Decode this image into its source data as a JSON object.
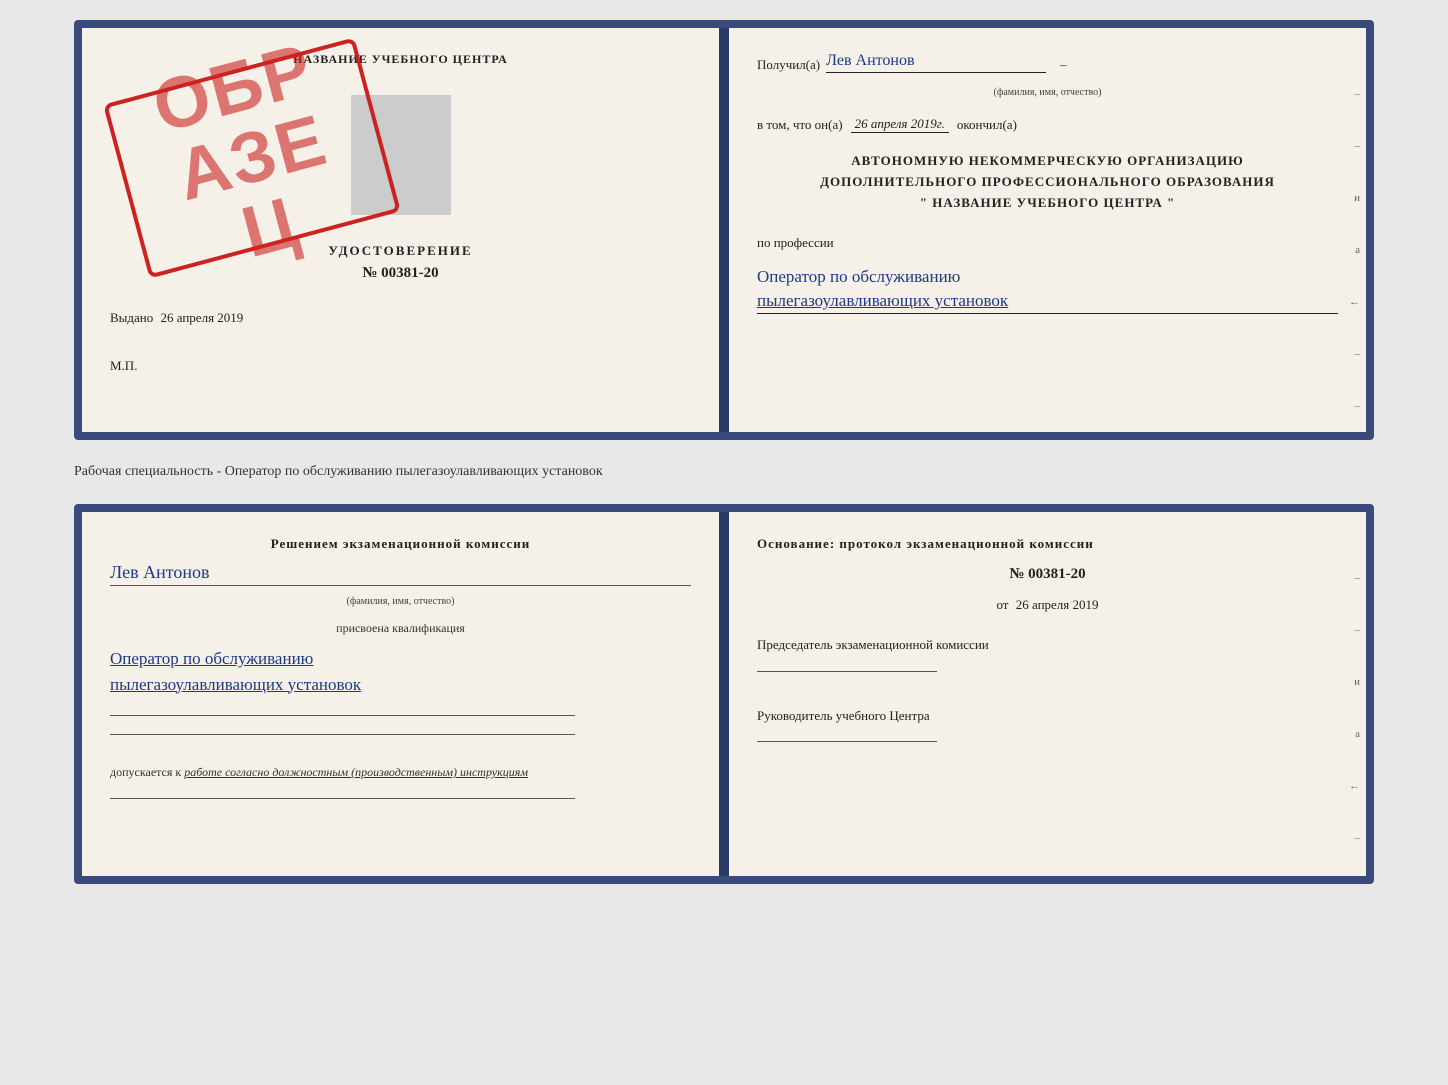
{
  "cert": {
    "left": {
      "center_name": "НАЗВАНИЕ УЧЕБНОГО ЦЕНТРА",
      "udostoverenie": "УДОСТОВЕРЕНИЕ",
      "number": "№ 00381-20",
      "stamp": "ОБР\nАЗЕЦ",
      "vydano_label": "Выдано",
      "vydano_date": "26 апреля 2019",
      "mp": "М.П."
    },
    "right": {
      "poluchil_label": "Получил(а)",
      "poluchil_name": "Лев Антонов",
      "fio_hint": "(фамилия, имя, отчество)",
      "dash": "–",
      "vtom_prefix": "в том, что он(а)",
      "vtom_date": "26 апреля 2019г.",
      "okonchil": "окончил(а)",
      "org_line1": "АВТОНОМНУЮ НЕКОММЕРЧЕСКУЮ ОРГАНИЗАЦИЮ",
      "org_line2": "ДОПОЛНИТЕЛЬНОГО ПРОФЕССИОНАЛЬНОГО ОБРАЗОВАНИЯ",
      "org_line3": "\"  НАЗВАНИЕ УЧЕБНОГО ЦЕНТРА  \"",
      "po_professii": "по профессии",
      "prof_line1": "Оператор по обслуживанию",
      "prof_line2": "пылегазоулавливающих установок"
    }
  },
  "middle_text": "Рабочая специальность - Оператор по обслуживанию пылегазоулавливающих установок",
  "bottom": {
    "left": {
      "resheniem": "Решением экзаменационной комиссии",
      "fio": "Лев Антонов",
      "fio_hint": "(фамилия, имя, отчество)",
      "prisvoena": "присвоена квалификация",
      "kvali_1": "Оператор по обслуживанию",
      "kvali_2": "пылегазоулавливающих установок",
      "dopusk_prefix": "допускается к",
      "dopusk_italic": "работе согласно должностным (производственным) инструкциям"
    },
    "right": {
      "osnovanie": "Основание: протокол экзаменационной комиссии",
      "number": "№  00381-20",
      "ot_prefix": "от",
      "ot_date": "26 апреля 2019",
      "predsedatel_label": "Председатель экзаменационной комиссии",
      "rukovoditel_label": "Руководитель учебного Центра"
    }
  },
  "side_labels": {
    "i": "и",
    "a": "а",
    "arrow": "←"
  }
}
